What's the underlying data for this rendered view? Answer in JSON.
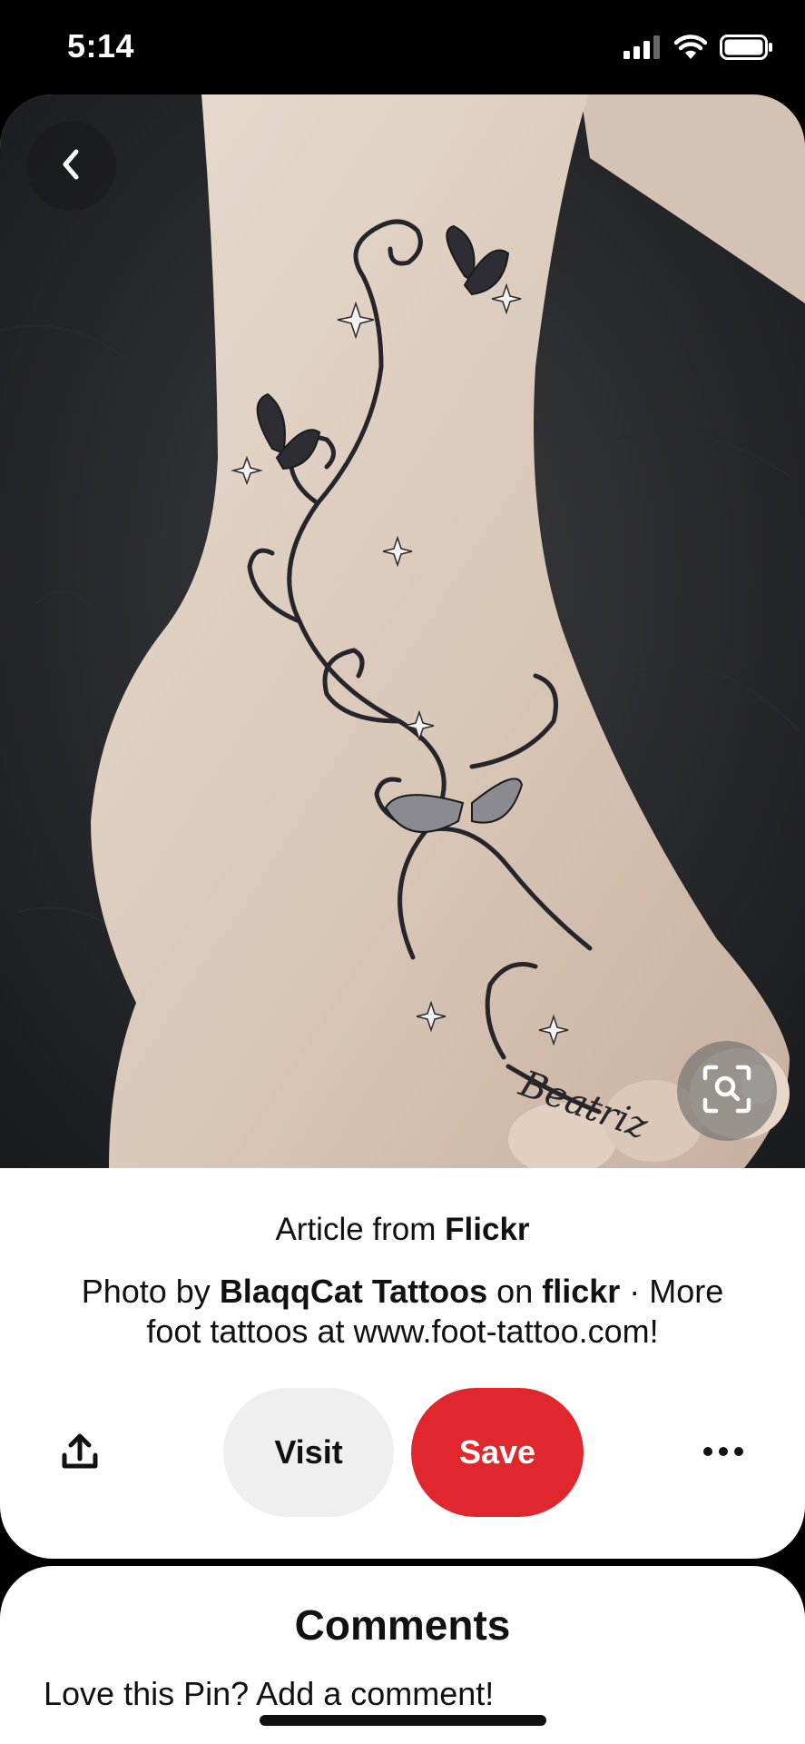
{
  "status_bar": {
    "time": "5:14",
    "icons": [
      "cellular-signal-icon",
      "wifi-icon",
      "battery-icon"
    ]
  },
  "pin": {
    "image_caption": "Beatriz",
    "source_prefix": "Article from",
    "source_name": "Flickr",
    "description": {
      "part1": "Photo by",
      "author": "BlaqqCat Tattoos",
      "part2": "on",
      "site": "flickr",
      "part3": "· More foot tattoos at www.foot-tattoo.com!"
    }
  },
  "actions": {
    "visit_label": "Visit",
    "save_label": "Save",
    "share_icon": "share-icon",
    "more_icon": "more-options-icon"
  },
  "comments": {
    "title": "Comments",
    "prompt_text": "Love this Pin? ",
    "prompt_link": "Add a comment!"
  },
  "colors": {
    "save": "#e0272e",
    "visit": "#efefef",
    "background": "#000000",
    "card": "#ffffff"
  }
}
